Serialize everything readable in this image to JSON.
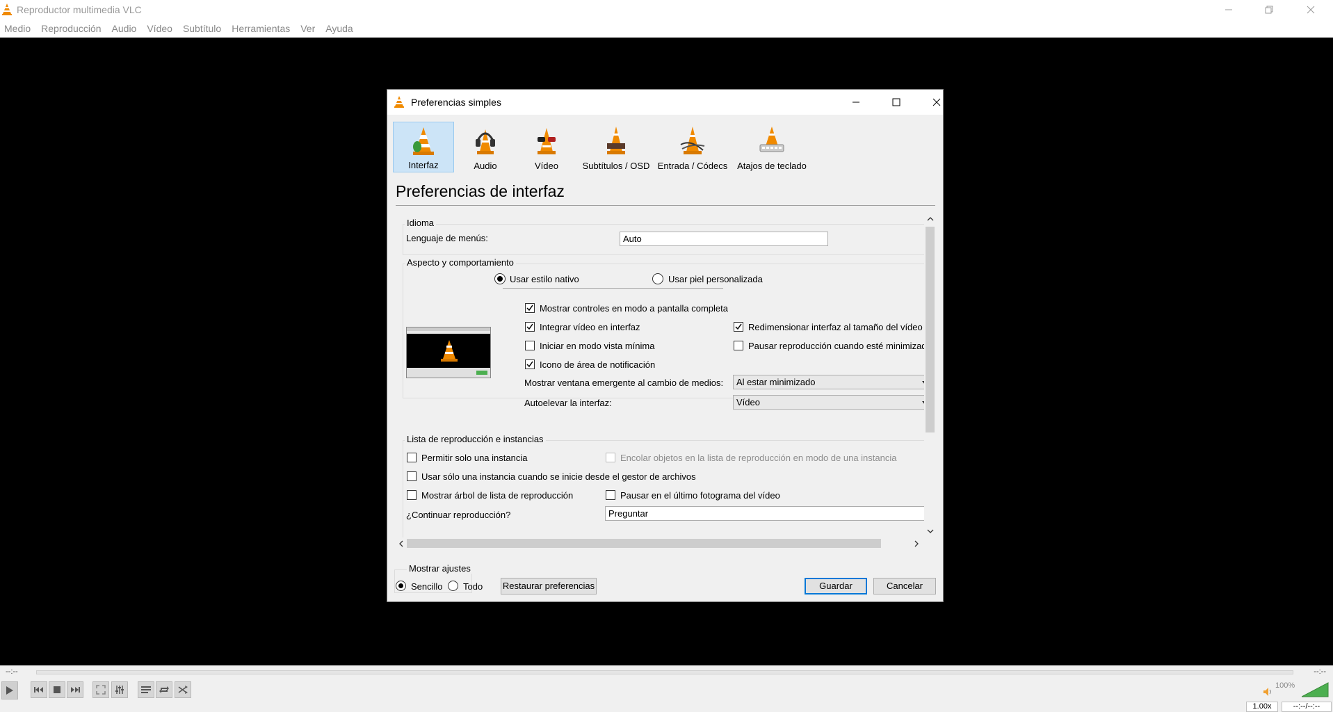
{
  "window": {
    "title": "Reproductor multimedia VLC"
  },
  "menubar": [
    "Medio",
    "Reproducción",
    "Audio",
    "Vídeo",
    "Subtítulo",
    "Herramientas",
    "Ver",
    "Ayuda"
  ],
  "dialog": {
    "title": "Preferencias simples",
    "categories": [
      {
        "label": "Interfaz",
        "icon": "vlc-cone-icon",
        "selected": true
      },
      {
        "label": "Audio",
        "icon": "headphones-cone-icon",
        "selected": false
      },
      {
        "label": "Vídeo",
        "icon": "glasses-cone-icon",
        "selected": false
      },
      {
        "label": "Subtítulos / OSD",
        "icon": "subtitles-cone-icon",
        "selected": false
      },
      {
        "label": "Entrada / Códecs",
        "icon": "cable-cone-icon",
        "selected": false
      },
      {
        "label": "Atajos de teclado",
        "icon": "keyboard-cone-icon",
        "selected": false
      }
    ],
    "heading": "Preferencias de interfaz",
    "idioma": {
      "title": "Idioma",
      "menu_lang_label": "Lenguaje de menús:",
      "menu_lang_value": "Auto"
    },
    "aspecto": {
      "title": "Aspecto y comportamiento",
      "native_style": "Usar estilo nativo",
      "custom_skin": "Usar piel personalizada",
      "fullscreen_controls": "Mostrar controles en modo a pantalla completa",
      "embed_video": "Integrar vídeo en interfaz",
      "resize_interface": "Redimensionar interfaz al tamaño del vídeo",
      "minimal_view": "Iniciar en modo vista mínima",
      "pause_minimized": "Pausar reproducción cuando esté minimizado",
      "systray_icon": "Icono de área de notificación",
      "popup_label": "Mostrar ventana emergente al cambio de medios:",
      "popup_value": "Al estar minimizado",
      "raise_label": "Autoelevar la interfaz:",
      "raise_value": "Vídeo"
    },
    "playlist": {
      "title": "Lista de reproducción e instancias",
      "one_instance": "Permitir solo una instancia",
      "enqueue": "Encolar objetos en la lista de reproducción en modo de una instancia",
      "file_manager": "Usar sólo una instancia cuando se inicie desde el gestor de archivos",
      "tree": "Mostrar árbol de lista de reproducción",
      "pause_last": "Pausar en el último fotograma del vídeo",
      "continue_label": "¿Continuar reproducción?",
      "continue_value": "Preguntar"
    },
    "show_settings": {
      "title": "Mostrar ajustes",
      "simple": "Sencillo",
      "all": "Todo"
    },
    "buttons": {
      "reset": "Restaurar preferencias",
      "save": "Guardar",
      "cancel": "Cancelar"
    }
  },
  "player": {
    "elapsed": "--:--",
    "remaining": "--:--",
    "volume": "100%",
    "speed": "1.00x",
    "total_time": "--:--/--:--"
  }
}
